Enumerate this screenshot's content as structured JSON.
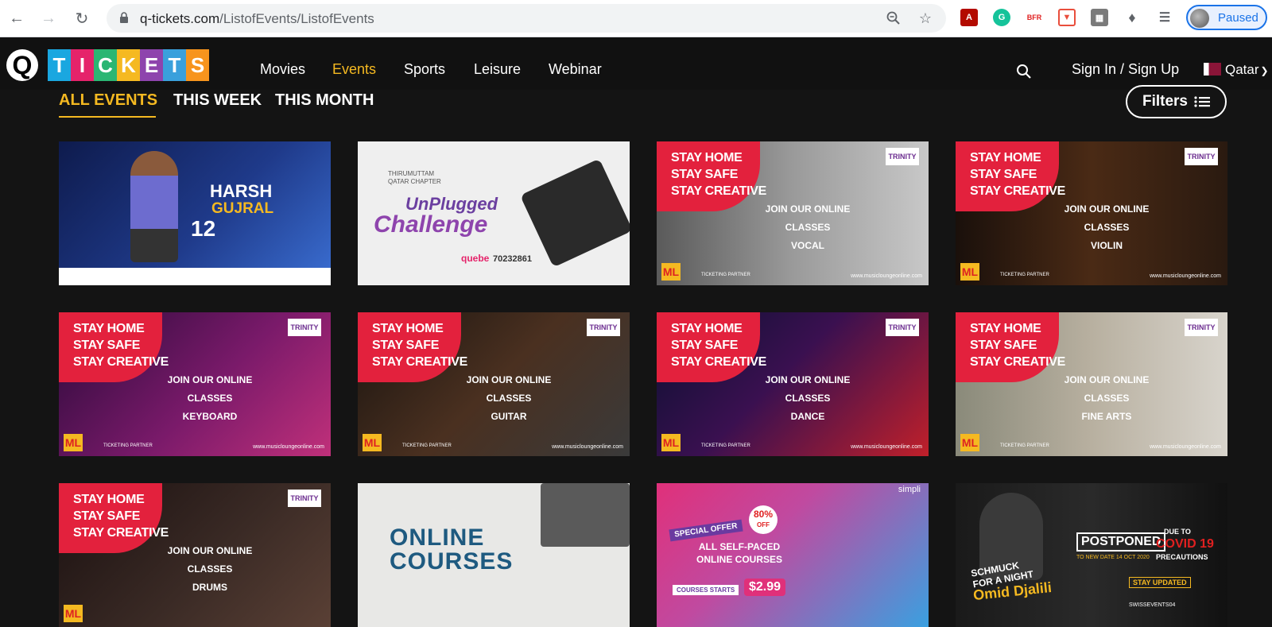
{
  "browser": {
    "url_domain": "q-tickets.com",
    "url_path": "/ListofEvents/ListofEvents",
    "profile_label": "Paused"
  },
  "header": {
    "logo_q": "Q",
    "logo_letters": [
      "T",
      "I",
      "C",
      "K",
      "E",
      "T",
      "S"
    ],
    "logo_colors": [
      "#1aa7e0",
      "#e5236a",
      "#2bb673",
      "#f5b921",
      "#8e44ad",
      "#3aa0dc",
      "#f7941d"
    ],
    "nav": [
      "Movies",
      "Events",
      "Sports",
      "Leisure",
      "Webinar"
    ],
    "active_nav": "Events",
    "signin": "Sign In / Sign Up",
    "country": "Qatar"
  },
  "tabs": {
    "items": [
      "ALL EVENTS",
      "THIS WEEK",
      "THIS MONTH"
    ],
    "active": "ALL EVENTS",
    "filters_label": "Filters"
  },
  "cards": {
    "harsh": {
      "name1": "HARSH",
      "name2": "GUJRAL",
      "date": "12"
    },
    "unplugged": {
      "org": "THIRUMUTTAM QATAR CHAPTER",
      "title1": "UnPlugged",
      "title2": "Challenge",
      "sponsor": "quebe",
      "phone": "70232861"
    },
    "promo": {
      "line1": "STAY HOME",
      "line2": "STAY SAFE",
      "line3": "STAY CREATIVE",
      "join": "JOIN OUR ONLINE CLASSES",
      "badge": "TRINITY",
      "ml": "ML",
      "website": "www.musicloungeonline.com",
      "partner": "TICKETING PARTNER"
    },
    "classes": [
      "VOCAL",
      "VIOLIN",
      "KEYBOARD",
      "GUITAR",
      "DANCE",
      "FINE ARTS",
      "DRUMS"
    ],
    "online_courses": {
      "line1": "ONLINE",
      "line2": "COURSES"
    },
    "simplilearn": {
      "brand": "simpli",
      "offer": "SPECIAL OFFER",
      "discount": "80%",
      "discount_sub": "OFF",
      "line1": "ALL SELF-PACED",
      "line2": "ONLINE COURSES",
      "starts": "COURSES STARTS",
      "price": "$2.99"
    },
    "omid": {
      "show1": "SCHMUCK",
      "show2": "FOR A NIGHT",
      "performer": "Omid Djalili",
      "postponed": "POSTPONED",
      "new_date": "TO NEW DATE 14 OCT 2020",
      "due": "DUE TO",
      "covid": "COVID 19",
      "precautions": "PRECAUTIONS",
      "stay": "STAY UPDATED",
      "handle": "SWISSEVENTS04"
    }
  }
}
